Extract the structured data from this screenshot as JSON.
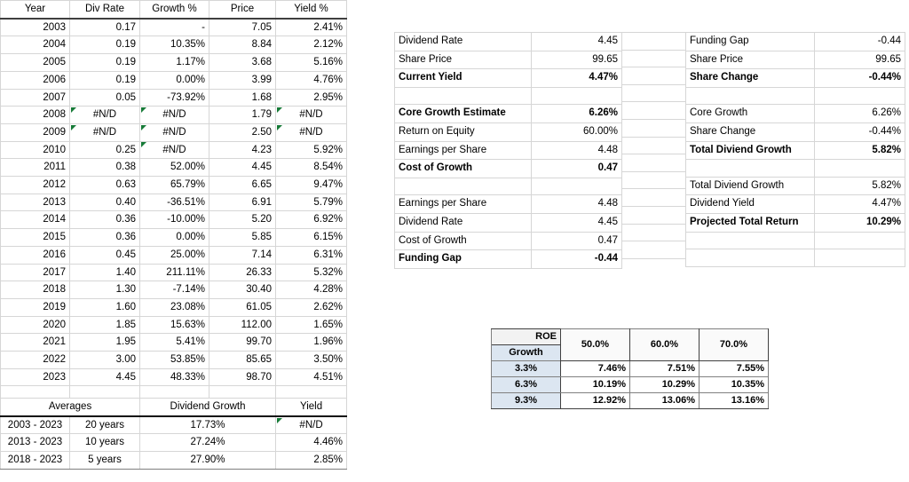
{
  "dividend_table": {
    "columns": [
      "Year",
      "Div Rate",
      "Growth %",
      "Price",
      "Yield %"
    ],
    "rows": [
      {
        "year": "2003",
        "div_rate": "0.17",
        "growth": "-",
        "price": "7.05",
        "yield": "2.41%"
      },
      {
        "year": "2004",
        "div_rate": "0.19",
        "growth": "10.35%",
        "price": "8.84",
        "yield": "2.12%"
      },
      {
        "year": "2005",
        "div_rate": "0.19",
        "growth": "1.17%",
        "price": "3.68",
        "yield": "5.16%"
      },
      {
        "year": "2006",
        "div_rate": "0.19",
        "growth": "0.00%",
        "price": "3.99",
        "yield": "4.76%"
      },
      {
        "year": "2007",
        "div_rate": "0.05",
        "growth": "-73.92%",
        "price": "1.68",
        "yield": "2.95%"
      },
      {
        "year": "2008",
        "div_rate": "#N/D",
        "growth": "#N/D",
        "price": "1.79",
        "yield": "#N/D"
      },
      {
        "year": "2009",
        "div_rate": "#N/D",
        "growth": "#N/D",
        "price": "2.50",
        "yield": "#N/D"
      },
      {
        "year": "2010",
        "div_rate": "0.25",
        "growth": "#N/D",
        "price": "4.23",
        "yield": "5.92%"
      },
      {
        "year": "2011",
        "div_rate": "0.38",
        "growth": "52.00%",
        "price": "4.45",
        "yield": "8.54%"
      },
      {
        "year": "2012",
        "div_rate": "0.63",
        "growth": "65.79%",
        "price": "6.65",
        "yield": "9.47%"
      },
      {
        "year": "2013",
        "div_rate": "0.40",
        "growth": "-36.51%",
        "price": "6.91",
        "yield": "5.79%"
      },
      {
        "year": "2014",
        "div_rate": "0.36",
        "growth": "-10.00%",
        "price": "5.20",
        "yield": "6.92%"
      },
      {
        "year": "2015",
        "div_rate": "0.36",
        "growth": "0.00%",
        "price": "5.85",
        "yield": "6.15%"
      },
      {
        "year": "2016",
        "div_rate": "0.45",
        "growth": "25.00%",
        "price": "7.14",
        "yield": "6.31%"
      },
      {
        "year": "2017",
        "div_rate": "1.40",
        "growth": "211.11%",
        "price": "26.33",
        "yield": "5.32%"
      },
      {
        "year": "2018",
        "div_rate": "1.30",
        "growth": "-7.14%",
        "price": "30.40",
        "yield": "4.28%"
      },
      {
        "year": "2019",
        "div_rate": "1.60",
        "growth": "23.08%",
        "price": "61.05",
        "yield": "2.62%"
      },
      {
        "year": "2020",
        "div_rate": "1.85",
        "growth": "15.63%",
        "price": "112.00",
        "yield": "1.65%"
      },
      {
        "year": "2021",
        "div_rate": "1.95",
        "growth": "5.41%",
        "price": "99.70",
        "yield": "1.96%"
      },
      {
        "year": "2022",
        "div_rate": "3.00",
        "growth": "53.85%",
        "price": "85.65",
        "yield": "3.50%"
      },
      {
        "year": "2023",
        "div_rate": "4.45",
        "growth": "48.33%",
        "price": "98.70",
        "yield": "4.51%"
      }
    ]
  },
  "averages_table": {
    "headers": {
      "range": "Averages",
      "growth": "Dividend Growth",
      "yield": "Yield"
    },
    "rows": [
      {
        "range": "2003 - 2023",
        "years": "20 years",
        "growth": "17.73%",
        "yield": "#N/D"
      },
      {
        "range": "2013 - 2023",
        "years": "10 years",
        "growth": "27.24%",
        "yield": "4.46%"
      },
      {
        "range": "2018 - 2023",
        "years": "5 years",
        "growth": "27.90%",
        "yield": "2.85%"
      }
    ]
  },
  "calc_left": {
    "rows": [
      {
        "label": "Dividend Rate",
        "value": "4.45"
      },
      {
        "label": "Share Price",
        "value": "99.65"
      },
      {
        "label": "Current Yield",
        "value": "4.47%"
      },
      {
        "label": "",
        "value": ""
      },
      {
        "label": "Core Growth Estimate",
        "value": "6.26%"
      },
      {
        "label": "Return on Equity",
        "value": "60.00%"
      },
      {
        "label": "Earnings per Share",
        "value": "4.48"
      },
      {
        "label": "Cost of Growth",
        "value": "0.47"
      },
      {
        "label": "",
        "value": ""
      },
      {
        "label": "Earnings per Share",
        "value": "4.48"
      },
      {
        "label": "Dividend Rate",
        "value": "4.45"
      },
      {
        "label": "Cost of Growth",
        "value": "0.47"
      },
      {
        "label": "Funding Gap",
        "value": "-0.44"
      }
    ]
  },
  "calc_right": {
    "rows": [
      {
        "label": "Funding Gap",
        "value": "-0.44"
      },
      {
        "label": "Share Price",
        "value": "99.65"
      },
      {
        "label": "Share Change",
        "value": "-0.44%"
      },
      {
        "label": "",
        "value": ""
      },
      {
        "label": "Core Growth",
        "value": "6.26%"
      },
      {
        "label": "Share Change",
        "value": "-0.44%"
      },
      {
        "label": "Total Diviend Growth",
        "value": "5.82%"
      },
      {
        "label": "",
        "value": ""
      },
      {
        "label": "Total Diviend Growth",
        "value": "5.82%"
      },
      {
        "label": "Dividend Yield",
        "value": "4.47%"
      },
      {
        "label": "Projected Total Return",
        "value": "10.29%"
      },
      {
        "label": "",
        "value": ""
      },
      {
        "label": "",
        "value": ""
      }
    ]
  },
  "matrix": {
    "corner_top": "ROE",
    "corner_bottom": "Growth",
    "col_headers": [
      "50.0%",
      "60.0%",
      "70.0%"
    ],
    "row_headers": [
      "3.3%",
      "6.3%",
      "9.3%"
    ],
    "values": [
      [
        "7.46%",
        "7.51%",
        "7.55%"
      ],
      [
        "10.19%",
        "10.29%",
        "10.35%"
      ],
      [
        "12.92%",
        "13.06%",
        "13.16%"
      ]
    ]
  },
  "colors": {
    "row_header_fill": "#dce6f1",
    "corner_fill": "#f2f2f2",
    "col_header_fill": "#fafafa",
    "grid": "#d6d6d6",
    "heavy_rule": "#3f3f3f",
    "error_flag": "#167a37"
  }
}
